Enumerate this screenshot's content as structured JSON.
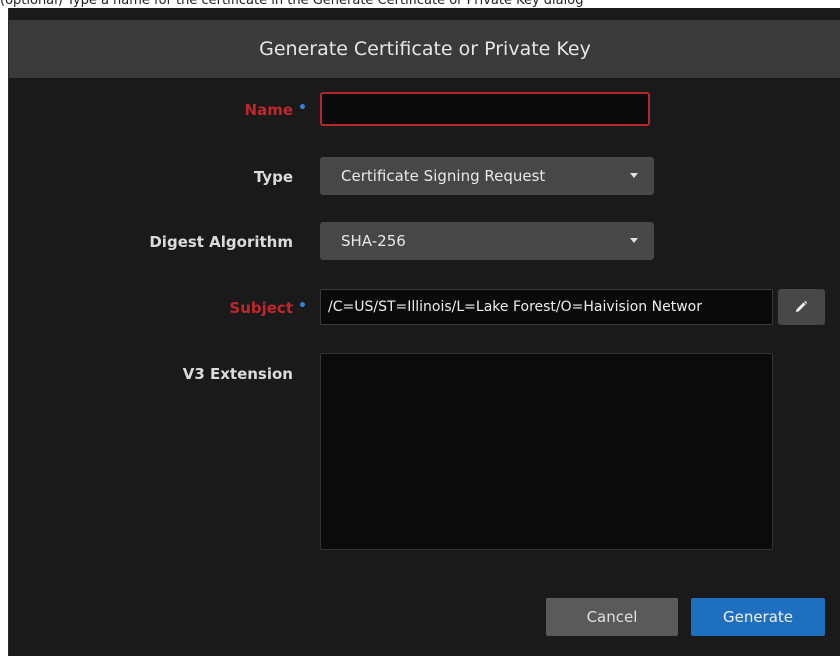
{
  "page": {
    "caption": "(optional) Type a name for the certificate in the Generate Certificate or Private Key dialog"
  },
  "dialog": {
    "title": "Generate Certificate or Private Key",
    "fields": {
      "name": {
        "label": "Name",
        "required_mark": "•",
        "value": "",
        "placeholder": ""
      },
      "type": {
        "label": "Type",
        "selected": "Certificate Signing Request"
      },
      "digest": {
        "label": "Digest Algorithm",
        "selected": "SHA-256"
      },
      "subject": {
        "label": "Subject",
        "required_mark": "•",
        "value": "/C=US/ST=Illinois/L=Lake Forest/O=Haivision Networ"
      },
      "v3": {
        "label": "V3 Extension",
        "value": ""
      }
    },
    "buttons": {
      "cancel": "Cancel",
      "generate": "Generate"
    },
    "icons": {
      "edit": "pencil-icon",
      "dropdown": "caret-down-icon"
    },
    "colors": {
      "required_label": "#c0272d",
      "required_mark": "#2f86d4",
      "primary_button": "#1e6fbf",
      "error_border": "#b3282c"
    }
  }
}
